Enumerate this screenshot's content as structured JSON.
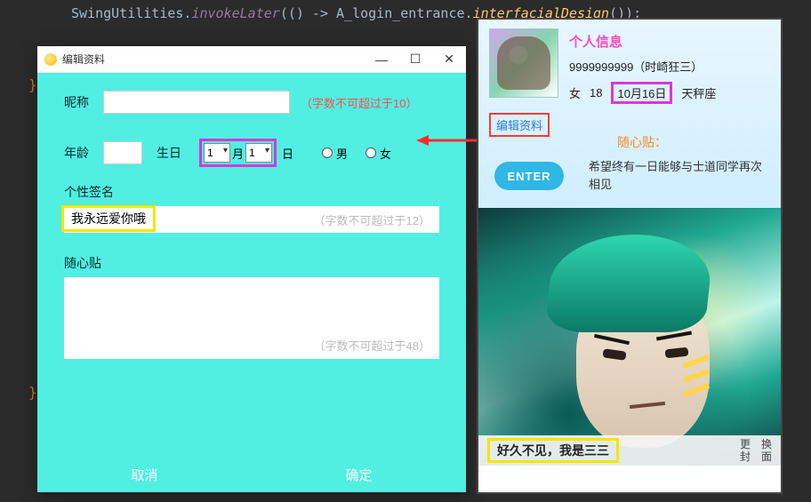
{
  "code_line": {
    "prefix": "SwingUtilities.",
    "invoke": "invokeLater",
    "mid": "(() -> ",
    "cls": "A_login_entrance",
    "dot": ".",
    "method": "interfacialDesign",
    "suffix": "());"
  },
  "edit_dialog": {
    "title": "编辑资料",
    "minimize": "—",
    "maximize": "☐",
    "close": "✕",
    "nickname_label": "昵称",
    "nickname_value": "",
    "nickname_hint": "（字数不可超过于10）",
    "age_label": "年龄",
    "age_value": "",
    "birthday_label": "生日",
    "month_value": "1",
    "month_unit": "月",
    "day_value": "1",
    "day_unit": "日",
    "gender_male": "男",
    "gender_female": "女",
    "signature_label": "个性签名",
    "signature_value": "我永远爱你哦",
    "signature_hint": "（字数不可超过于12）",
    "note_label": "随心贴",
    "note_value": "",
    "note_hint": "（字数不可超过于48）",
    "cancel": "取消",
    "ok": "确定"
  },
  "profile": {
    "minimize": "—",
    "close": "✕",
    "title": "个人信息",
    "id_name": "9999999999（时崎狂三）",
    "gender": "女",
    "age": "18",
    "birthday": "10月16日",
    "zodiac": "天秤座",
    "edit_link": "编辑资料",
    "note_label": "随心贴：",
    "enter": "ENTER",
    "wish": "希望终有一日能够与士道同学再次相见",
    "caption": "好久不见，我是三三",
    "change_line1": "更　换",
    "change_line2": "封　面"
  },
  "highlight_colors": {
    "magenta": "#d63ad6",
    "yellow": "#f5e600",
    "red": "#ff3b3b"
  }
}
